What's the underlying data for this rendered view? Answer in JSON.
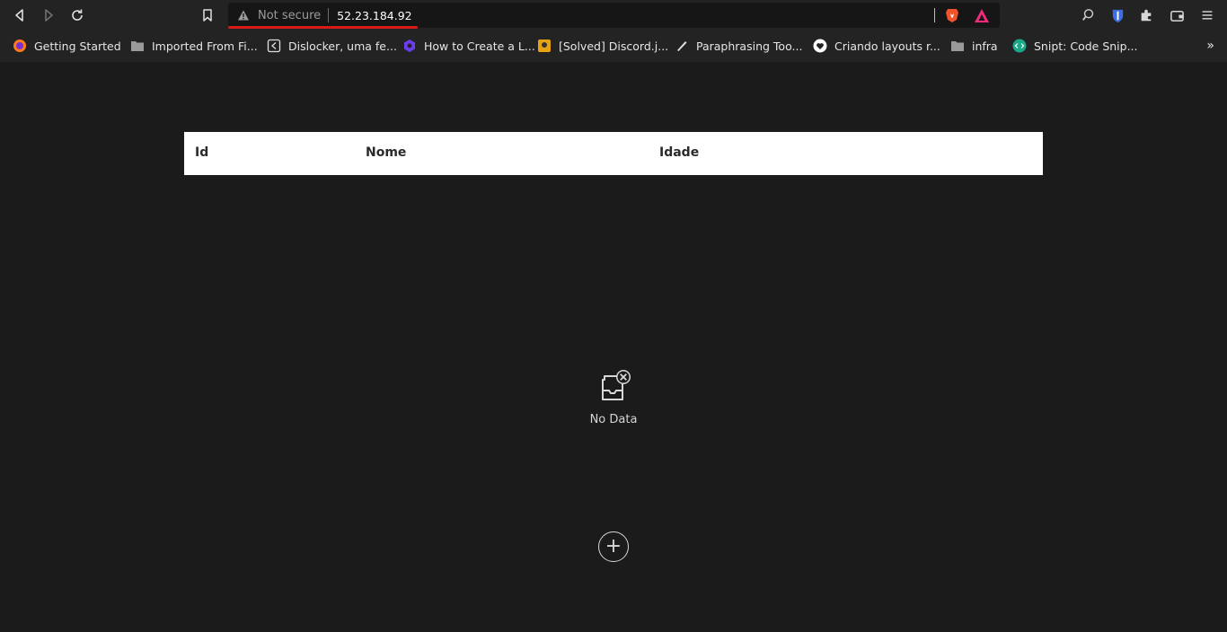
{
  "browser": {
    "address": {
      "security_label": "Not secure",
      "url": "52.23.184.92"
    },
    "bookmarks": [
      {
        "label": "Getting Started",
        "icon": "firefox-icon"
      },
      {
        "label": "Imported From Fi...",
        "icon": "folder-icon"
      },
      {
        "label": "Dislocker, uma fe...",
        "icon": "share-icon"
      },
      {
        "label": "How to Create a L...",
        "icon": "hexagon-icon"
      },
      {
        "label": "[Solved] Discord.j...",
        "icon": "favicon-icon"
      },
      {
        "label": "Paraphrasing Too...",
        "icon": "pen-icon"
      },
      {
        "label": "Criando layouts r...",
        "icon": "heart-icon"
      },
      {
        "label": "infra",
        "icon": "folder-icon"
      },
      {
        "label": "Snipt: Code Snip...",
        "icon": "code-icon"
      }
    ],
    "accent_colors": {
      "underline": "#d71b1b",
      "brave": "#f0542a"
    }
  },
  "table": {
    "columns": [
      "Id",
      "Nome",
      "Idade"
    ],
    "empty_text": "No Data"
  },
  "add_button_symbol": "+"
}
